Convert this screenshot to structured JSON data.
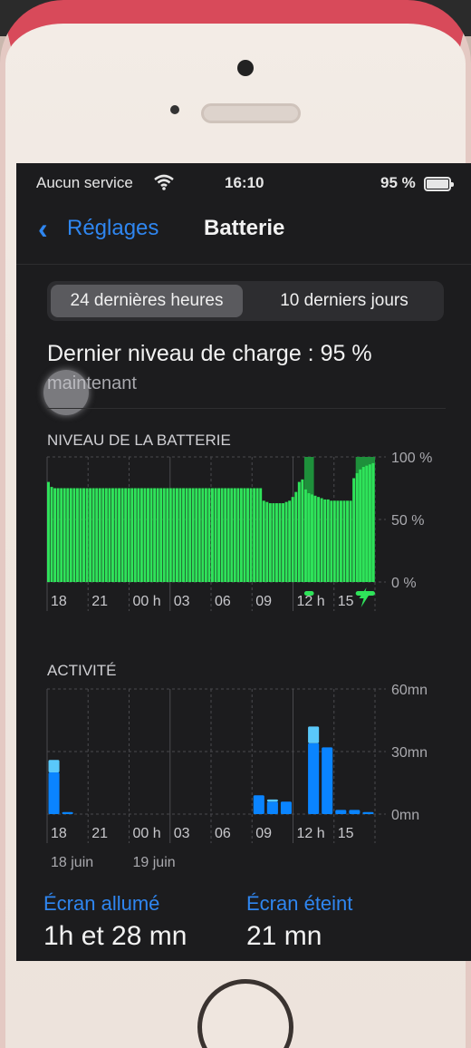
{
  "status_bar": {
    "carrier": "Aucun service",
    "time": "16:10",
    "battery_percent": "95 %",
    "icons": [
      "wifi-icon",
      "battery-icon"
    ]
  },
  "nav": {
    "back_label": "Réglages",
    "title": "Batterie"
  },
  "segmented": {
    "options": [
      "24 dernières heures",
      "10 derniers jours"
    ],
    "selected": "24 dernières heures"
  },
  "charge": {
    "title": "Dernier niveau de charge : 95 %",
    "subtitle": "maintenant"
  },
  "chart_data": [
    {
      "type": "bar",
      "title": "NIVEAU DE LA BATTERIE",
      "y_tick_labels": [
        "100 %",
        "50 %",
        "0 %"
      ],
      "ylim": [
        0,
        100
      ],
      "x_tick_labels": [
        "18",
        "21",
        "00 h",
        "03",
        "06",
        "09",
        "12 h",
        "15"
      ],
      "series": [
        {
          "values": [
            80,
            76,
            75,
            75,
            75,
            75,
            75,
            75,
            75,
            75,
            75,
            75,
            75,
            75,
            75,
            75,
            75,
            75,
            75,
            75,
            75,
            75,
            75,
            75,
            75,
            75,
            75,
            75,
            75,
            75,
            75,
            75,
            75,
            75,
            75,
            75,
            75,
            75,
            75,
            75,
            75,
            75,
            75,
            75,
            75,
            75,
            75,
            75,
            75,
            75,
            75,
            75,
            75,
            75,
            75,
            75,
            75,
            75,
            75,
            75,
            75,
            75,
            75,
            75,
            75,
            75,
            75,
            65,
            64,
            63,
            63,
            63,
            63,
            63,
            64,
            65,
            68,
            72,
            80,
            82,
            74,
            71,
            70,
            69,
            68,
            67,
            66,
            66,
            65,
            65,
            65,
            65,
            65,
            65,
            65,
            83,
            87,
            90,
            92,
            93,
            94,
            95
          ],
          "color": "#2fe35a"
        }
      ],
      "charging_bands": [
        {
          "start_index": 80,
          "end_index": 82
        },
        {
          "start_index": 96,
          "end_index": 101
        }
      ],
      "charging_icon": "lightning-icon",
      "color_charging": "#1f9d3e"
    },
    {
      "type": "bar",
      "title": "ACTIVITÉ",
      "y_tick_labels": [
        "60mn",
        "30mn",
        "0mn"
      ],
      "ylim": [
        0,
        60
      ],
      "x_tick_labels": [
        "18",
        "21",
        "00 h",
        "03",
        "06",
        "09",
        "12 h",
        "15"
      ],
      "date_labels": [
        "18 juin",
        "19 juin"
      ],
      "slots": 24,
      "series": [
        {
          "name": "Écran allumé",
          "values": [
            20,
            1,
            0,
            0,
            0,
            0,
            0,
            0,
            0,
            0,
            0,
            0,
            0,
            0,
            0,
            9,
            6,
            6,
            0,
            34,
            32,
            2,
            2,
            1
          ],
          "color": "#0a84ff"
        },
        {
          "name": "Écran éteint",
          "values": [
            6,
            0,
            0,
            0,
            0,
            0,
            0,
            0,
            0,
            0,
            0,
            0,
            0,
            0,
            0,
            0,
            1,
            0,
            0,
            8,
            0,
            0,
            0,
            0
          ],
          "color": "#5ac8fa"
        }
      ]
    }
  ],
  "stats": {
    "screen_on_label": "Écran allumé",
    "screen_on_value": "1h et 28 mn",
    "screen_off_label": "Écran éteint",
    "screen_off_value": "21 mn"
  }
}
